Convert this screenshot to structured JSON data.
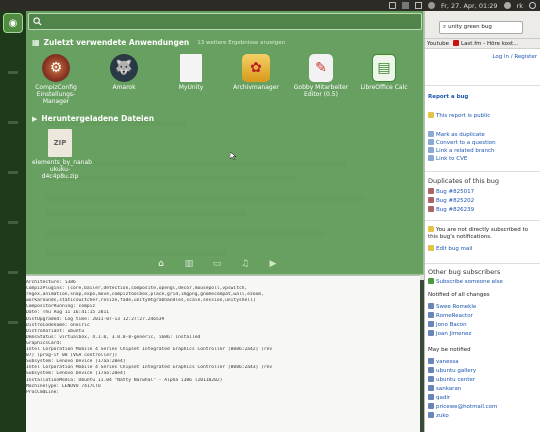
{
  "topbar": {
    "datetime": "Fr, 27. Apr, 01:29",
    "user": "rk"
  },
  "dash": {
    "search_placeholder": "",
    "recent_apps": {
      "title": "Zuletzt verwendete Anwendungen",
      "more": "13 weitere Ergebnisse anzeigen",
      "items": [
        {
          "label": "CompizConfig Einstellungs-Manager",
          "icon": "gear-icon"
        },
        {
          "label": "Amarok",
          "icon": "wolf-icon"
        },
        {
          "label": "MyUnity",
          "icon": "document-icon"
        },
        {
          "label": "Archivmanager",
          "icon": "archive-icon"
        },
        {
          "label": "Gobby Mitarbeiter Editor (0.5)",
          "icon": "editor-icon"
        },
        {
          "label": "LibreOffice Calc",
          "icon": "spreadsheet-icon"
        }
      ]
    },
    "downloads": {
      "title": "Heruntergeladene Dateien",
      "items": [
        {
          "label": "elements_by_nanab ukuku-d4c4p8u.zip",
          "icon": "zip-icon",
          "badge": "ZIP"
        }
      ]
    },
    "tabs": [
      "home-icon",
      "apps-icon",
      "files-icon",
      "music-icon",
      "video-icon"
    ]
  },
  "terminal": {
    "lines": [
      "Architecture: i386",
      "CompizPlugins: [core,bailer,detection,composite,opengl,decor,mousepoll,vpswitch,",
      "regex,animation,snap,expo,move,compiztoolbox,place,grid,imgpng,gnomecompat,wall,ezoom,",
      "workarounds,staticswitcher,resize,fade,unitymtgrabhandles,scale,session,unityshell]",
      "CompositorRunning: compiz",
      "Date: Thu Aug 11 16:41:15 2011",
      "DistUpgraded: Log time: 2011-07-13 12:27:27.246539",
      "DistroCodename: oneiric",
      "DistroVariant: ubuntu",
      "DkmsStatus: virtualbox, 4.1.0, 3.0.0-8-generic, i686: installed",
      "GraphicsCard:",
      " Intel Corporation Mobile 4 Series Chipset Integrated Graphics Controller [8086:2a42] (rev",
      "07) (prog-if 00 [VGA controller])",
      "   Subsystem: Lenovo Device [17aa:20e4]",
      " Intel Corporation Mobile 4 Series Chipset Integrated Graphics Controller [8086:2a43] (rev",
      "   Subsystem: Lenovo Device [17aa:20e4]",
      "InstallationMedia: Ubuntu 11.04 \"Natty Narwhal\" - Alpha i386 (20110202)",
      "MachineType: LENOVO 7417CTO",
      "ProcCmdLine:"
    ]
  },
  "browser": {
    "url": "unity green bug",
    "bookmarks": [
      "Youtube",
      "Last.fm - Höre kost..."
    ],
    "login": "Log in / Register",
    "report": "Report a bug",
    "public": "This report is public",
    "actions": [
      "Mark as duplicate",
      "Convert to a question",
      "Link a related branch",
      "Link to CVE"
    ],
    "duplicates_title": "Duplicates of this bug",
    "duplicates": [
      "Bug #825017",
      "Bug #825202",
      "Bug #826239"
    ],
    "subscribed_note": "You are not directly subscribed to this bug's notifications.",
    "edit_mail": "Edit bug mail",
    "other_subs_title": "Other bug subscribers",
    "subscribe_else": "Subscribe someone else",
    "notified_all": "Notified of all changes",
    "all_people": [
      "Swee Romekle",
      "RomeReactor",
      "Jono Bacon",
      "Joan Jimenez"
    ],
    "may_notified": "May be notified",
    "may_people": [
      "vanessa",
      "ubuntu gallery",
      "ubuntu center",
      "sankaran",
      "qadir",
      "pricewe@hotmail.com",
      "zuko"
    ]
  }
}
